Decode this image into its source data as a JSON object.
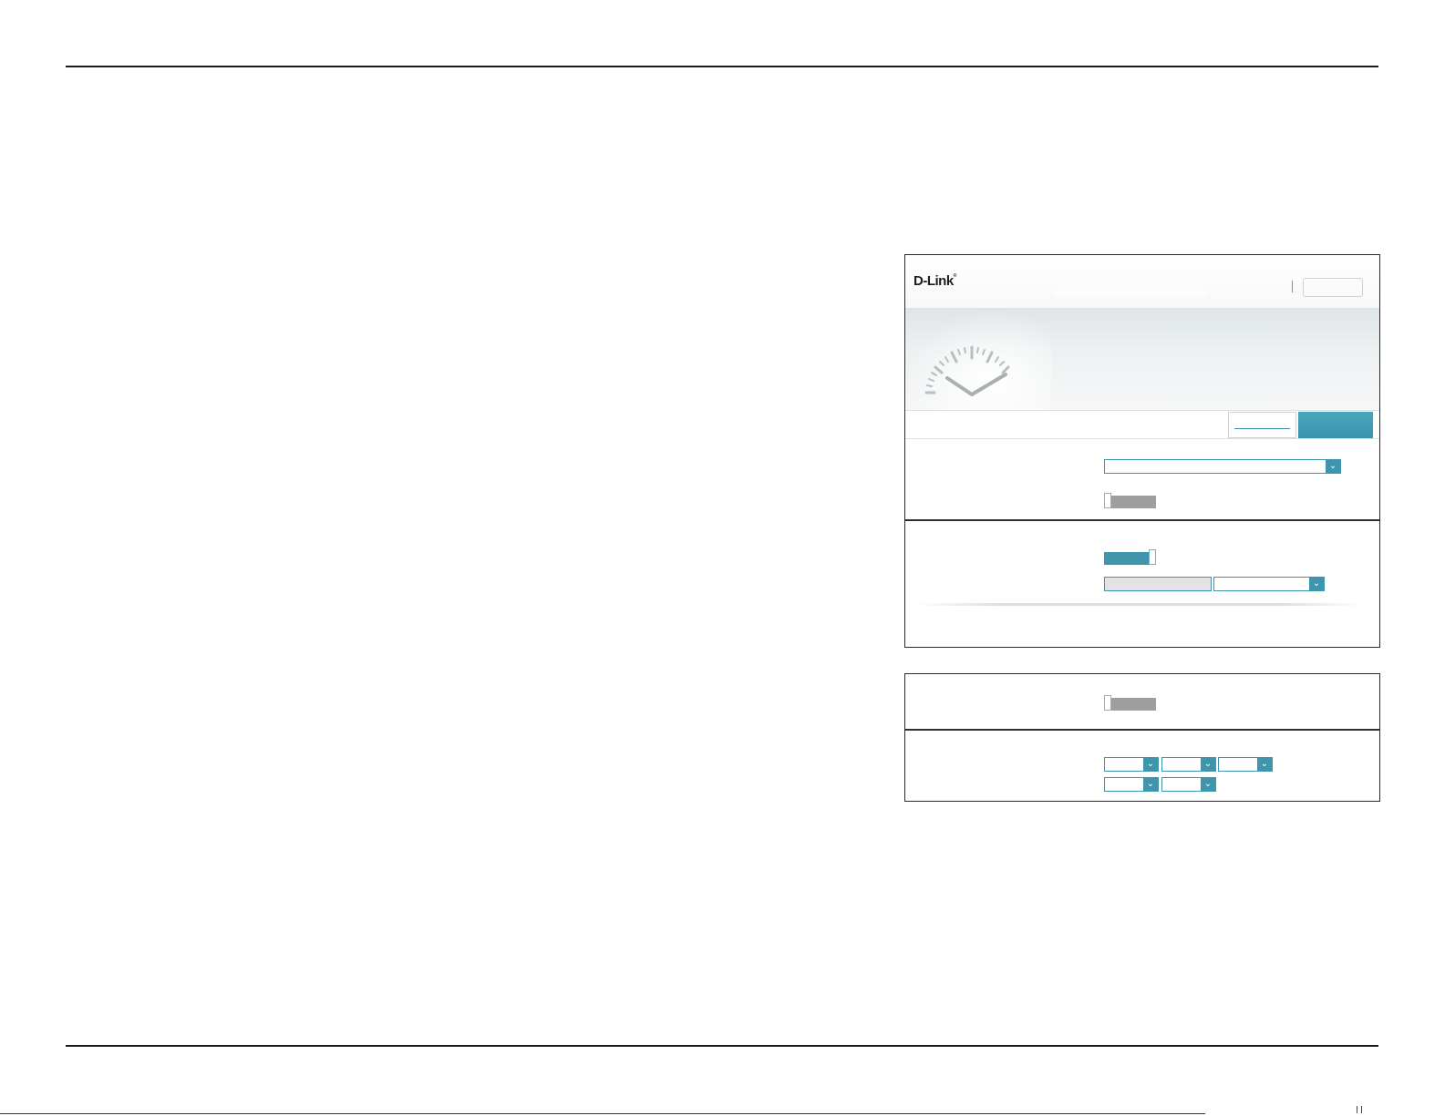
{
  "app": {
    "logo_text": "D-Link",
    "colors": {
      "accent": "#3f95ab",
      "toggle_off": "#9e9e9e",
      "frame": "#2a2a2a"
    }
  },
  "icons": {
    "gauge": "clock-gauge-icon",
    "dropdown": "chevron-down-icon"
  },
  "main_panel": {
    "time_zone": {
      "value": ""
    },
    "dst_toggle": {
      "state": "off"
    },
    "ntp_toggle": {
      "state": "on"
    },
    "ntp_server": {
      "value": "",
      "select_value": ""
    }
  },
  "schedule_panel": {
    "toggle": {
      "state": "off"
    },
    "datetime_selects": [
      {
        "value": ""
      },
      {
        "value": ""
      },
      {
        "value": ""
      },
      {
        "value": ""
      },
      {
        "value": ""
      }
    ]
  }
}
